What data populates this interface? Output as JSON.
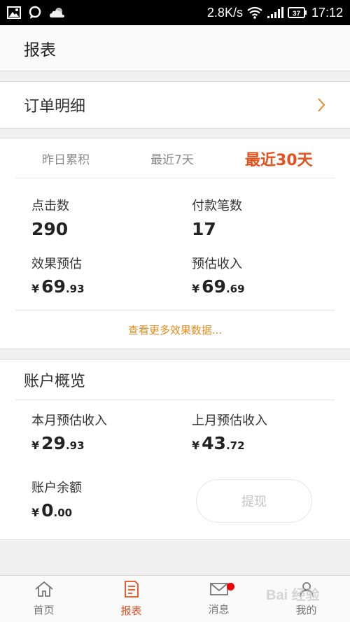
{
  "status_bar": {
    "network_speed": "2.8K/s",
    "battery": "37",
    "time": "17:12",
    "icons": [
      "image-icon",
      "chat-bubble-icon",
      "cloud-icon",
      "wifi-icon",
      "signal-icon",
      "battery-icon"
    ]
  },
  "header": {
    "title": "报表"
  },
  "order_row": {
    "label": "订单明细"
  },
  "stats": {
    "tabs": [
      {
        "label": "昨日累积",
        "active": false
      },
      {
        "label": "最近7天",
        "active": false
      },
      {
        "label": "最近30天",
        "active": true
      }
    ],
    "clicks": {
      "label": "点击数",
      "value": "290"
    },
    "payments": {
      "label": "付款笔数",
      "value": "17"
    },
    "effect_estimate": {
      "label": "效果预估",
      "currency": "¥",
      "int": "69",
      "dec": ".93"
    },
    "estimated_income": {
      "label": "预估收入",
      "currency": "¥",
      "int": "69",
      "dec": ".69"
    },
    "more_link": "查看更多效果数据..."
  },
  "account": {
    "title": "账户概览",
    "this_month": {
      "label": "本月预估收入",
      "currency": "¥",
      "int": "29",
      "dec": ".93"
    },
    "last_month": {
      "label": "上月预估收入",
      "currency": "¥",
      "int": "43",
      "dec": ".72"
    },
    "balance": {
      "label": "账户余额",
      "currency": "¥",
      "int": "0",
      "dec": ".00"
    },
    "withdraw_button": "提现"
  },
  "bottom_nav": [
    {
      "label": "首页",
      "icon": "home-icon",
      "active": false
    },
    {
      "label": "报表",
      "icon": "report-icon",
      "active": true
    },
    {
      "label": "消息",
      "icon": "mail-icon",
      "active": false,
      "badge": true
    },
    {
      "label": "我的",
      "icon": "user-icon",
      "active": false
    }
  ],
  "watermark": "Bai 经验",
  "colors": {
    "accent": "#e5511d",
    "link": "#e58a1d"
  }
}
